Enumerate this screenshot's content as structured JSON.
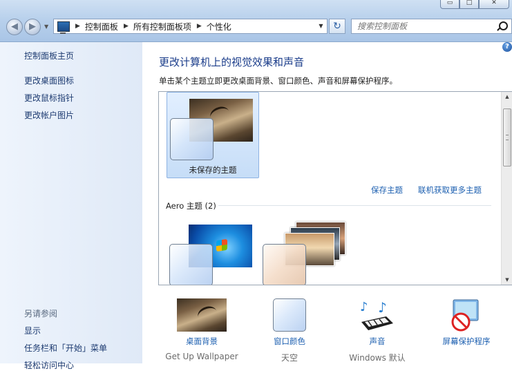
{
  "window": {
    "minimize_glyph": "▭",
    "maximize_glyph": "□",
    "close_glyph": "✕"
  },
  "address_bar": {
    "back_glyph": "◀",
    "forward_glyph": "▶",
    "crumbs": [
      "控制面板",
      "所有控制面板项",
      "个性化"
    ],
    "separator": "▶",
    "dropdown_glyph": "▼",
    "refresh_glyph": "↻"
  },
  "search": {
    "placeholder": "搜索控制面板"
  },
  "sidebar": {
    "home": "控制面板主页",
    "items": [
      "更改桌面图标",
      "更改鼠标指针",
      "更改帐户图片"
    ],
    "see_also_heading": "另请参阅",
    "see_also": [
      "显示",
      "任务栏和「开始」菜单",
      "轻松访问中心"
    ]
  },
  "main": {
    "help_glyph": "?",
    "title": "更改计算机上的视觉效果和声音",
    "description": "单击某个主题立即更改桌面背景、窗口颜色、声音和屏幕保护程序。",
    "unsaved_theme": "未保存的主题",
    "save_theme": "保存主题",
    "get_more_themes": "联机获取更多主题",
    "aero_heading": "Aero 主题 (2)"
  },
  "bottom": [
    {
      "label": "桌面背景",
      "value": "Get Up Wallpaper",
      "icon": "desktop-background-icon"
    },
    {
      "label": "窗口颜色",
      "value": "天空",
      "icon": "window-color-icon"
    },
    {
      "label": "声音",
      "value": "Windows 默认",
      "icon": "sounds-icon"
    },
    {
      "label": "屏幕保护程序",
      "value": "",
      "icon": "screensaver-icon"
    }
  ]
}
